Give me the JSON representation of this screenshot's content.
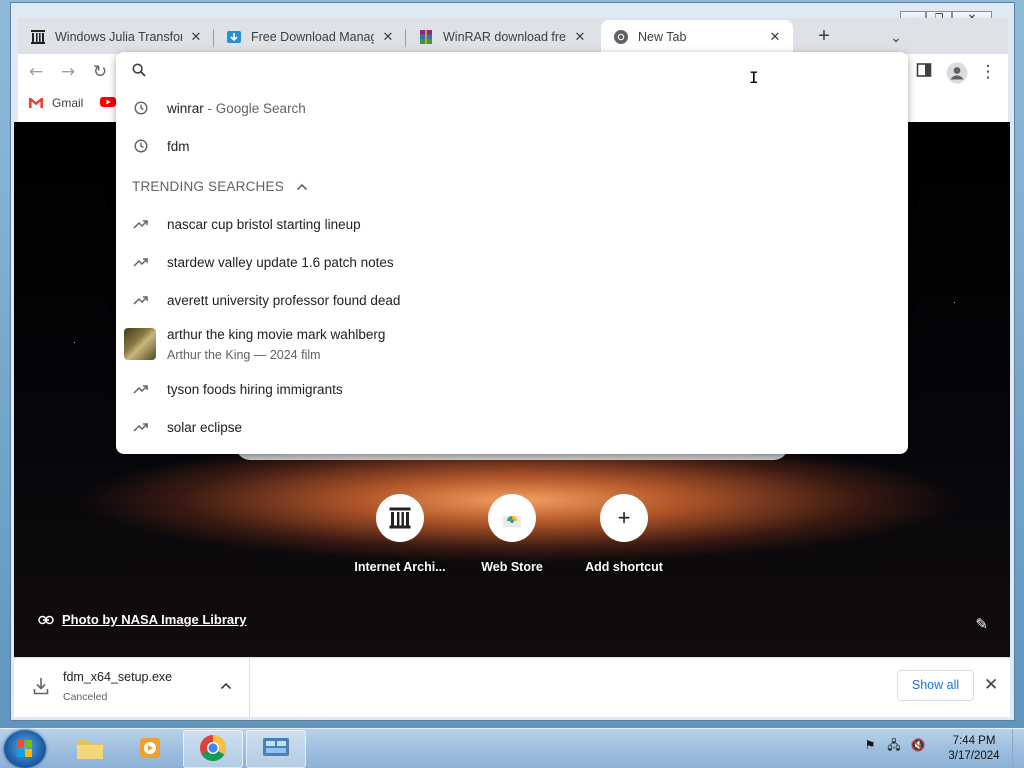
{
  "tabs": [
    {
      "title": "Windows Julia Transform",
      "favicon": "internet-archive-icon"
    },
    {
      "title": "Free Download Manager",
      "favicon": "fdm-icon"
    },
    {
      "title": "WinRAR download free",
      "favicon": "winrar-icon"
    },
    {
      "title": "New Tab",
      "favicon": "chrome-icon",
      "active": true
    }
  ],
  "bookmarks": [
    {
      "label": "Gmail",
      "icon": "gmail-icon"
    }
  ],
  "omnibox": {
    "value": "",
    "suggestions": [
      {
        "icon": "history-icon",
        "text": "winrar",
        "sub": " - Google Search"
      },
      {
        "icon": "history-icon",
        "text": "fdm",
        "sub": ""
      }
    ],
    "trending_header": "TRENDING SEARCHES",
    "trending": [
      {
        "text": "nascar cup bristol starting lineup"
      },
      {
        "text": "stardew valley update 1.6 patch notes"
      },
      {
        "text": "averett university professor found dead"
      },
      {
        "text": "arthur the king movie mark wahlberg",
        "sub": "Arthur the King — 2024 film",
        "thumbnail": true
      },
      {
        "text": "tyson foods hiring immigrants"
      },
      {
        "text": "solar eclipse"
      }
    ]
  },
  "ntp": {
    "shortcuts": [
      {
        "label": "Internet Archi...",
        "icon": "internet-archive-icon"
      },
      {
        "label": "Web Store",
        "icon": "web-store-icon"
      },
      {
        "label": "Add shortcut",
        "icon": "plus-icon"
      }
    ],
    "photo_credit": "Photo by NASA Image Library"
  },
  "download": {
    "filename": "fdm_x64_setup.exe",
    "status": "Canceled",
    "show_all": "Show all"
  },
  "taskbar": {
    "time": "7:44 PM",
    "date": "3/17/2024"
  },
  "colors": {
    "accent": "#1a73e8",
    "tabstrip": "#dee1e6",
    "taskbar": "#9fbfdf"
  }
}
